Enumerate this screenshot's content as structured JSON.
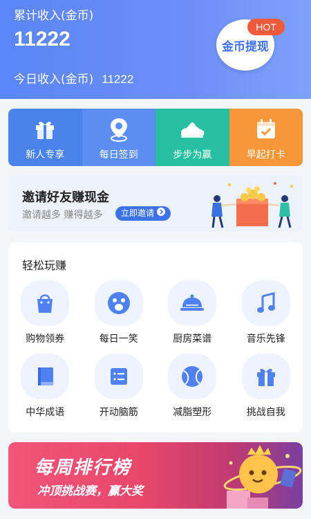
{
  "header": {
    "total_label": "累计收入(金币)",
    "total_value": "11222",
    "today_label": "今日收入(金币)",
    "today_value": "11222",
    "withdraw_label": "金币提现",
    "hot_badge": "HOT"
  },
  "actions": [
    {
      "label": "新人专享",
      "icon": "gift-icon"
    },
    {
      "label": "每日签到",
      "icon": "location-pin-icon"
    },
    {
      "label": "步步为赢",
      "icon": "sneaker-icon"
    },
    {
      "label": "早起打卡",
      "icon": "calendar-check-icon"
    }
  ],
  "invite": {
    "title": "邀请好友赚现金",
    "subtitle": "邀请越多 赚得越多",
    "button": "立即邀请"
  },
  "easy_earn": {
    "title": "轻松玩赚",
    "items": [
      {
        "label": "购物领券",
        "icon": "shopping-bag-icon"
      },
      {
        "label": "每日一笑",
        "icon": "laugh-face-icon"
      },
      {
        "label": "厨房菜谱",
        "icon": "cloche-icon"
      },
      {
        "label": "音乐先锋",
        "icon": "music-note-icon"
      },
      {
        "label": "中华成语",
        "icon": "book-icon"
      },
      {
        "label": "开动脑筋",
        "icon": "list-card-icon"
      },
      {
        "label": "减脂塑形",
        "icon": "ball-icon"
      },
      {
        "label": "挑战自我",
        "icon": "gift-box-icon"
      }
    ]
  },
  "weekly": {
    "title": "每周排行榜",
    "subtitle": "冲顶挑战赛，赢大奖"
  },
  "colors": {
    "header": "#5a86f7",
    "accent": "#3e73e8",
    "hot": "#f05a3c"
  }
}
